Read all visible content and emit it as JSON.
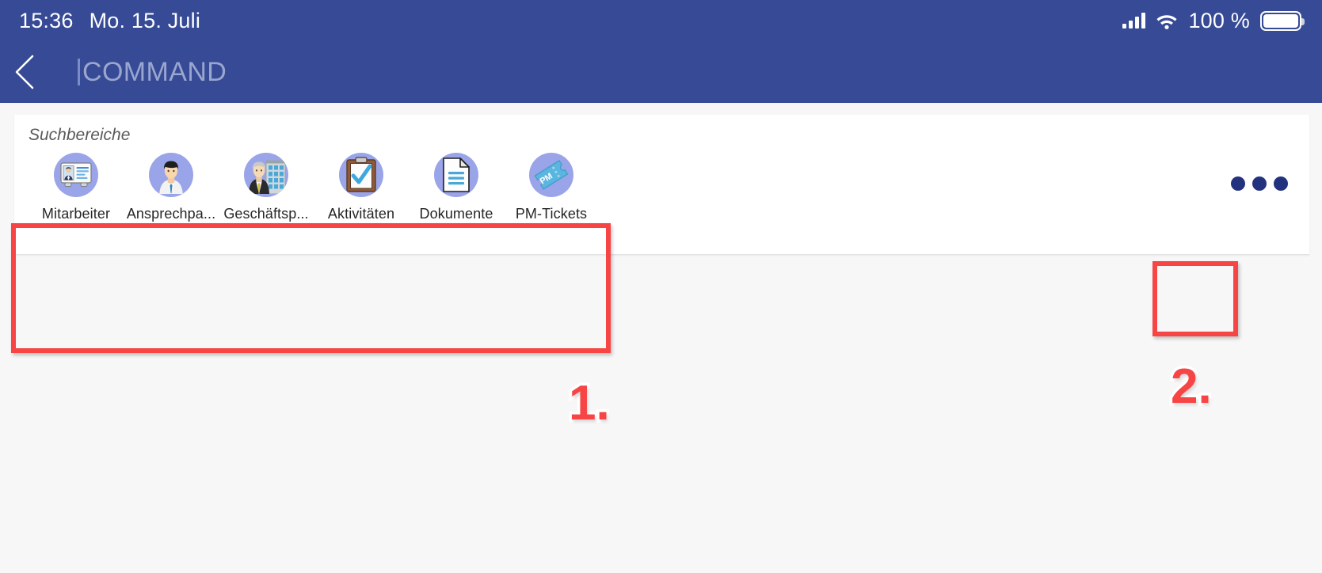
{
  "statusbar": {
    "time": "15:36",
    "date": "Mo. 15. Juli",
    "battery_percent": "100 %",
    "signal_icon": "cellular-signal-icon",
    "wifi_icon": "wifi-icon",
    "battery_icon": "battery-full-icon"
  },
  "navbar": {
    "back_icon": "back-chevron-icon",
    "title": "COMMAND",
    "background_color": "#364a96",
    "title_color": "#9aa6cf"
  },
  "card": {
    "title": "Suchbereiche",
    "areas": [
      {
        "label": "Mitarbeiter",
        "icon": "id-badge-icon"
      },
      {
        "label": "Ansprechpa...",
        "icon": "businessman-icon"
      },
      {
        "label": "Geschäftsp...",
        "icon": "business-partner-building-icon"
      },
      {
        "label": "Aktivitäten",
        "icon": "clipboard-check-icon"
      },
      {
        "label": "Dokumente",
        "icon": "document-icon"
      },
      {
        "label": "PM-Tickets",
        "icon": "ticket-pm-icon"
      }
    ],
    "icon_circle_color": "#9aa4e8"
  },
  "overflow": {
    "name": "more-options-button",
    "dots_color": "#23327e",
    "label": "•••"
  },
  "annotations": {
    "color": "#f74545",
    "items": [
      {
        "number": "1.",
        "target": "suchbereiche-panel"
      },
      {
        "number": "2.",
        "target": "more-options-button"
      }
    ]
  }
}
